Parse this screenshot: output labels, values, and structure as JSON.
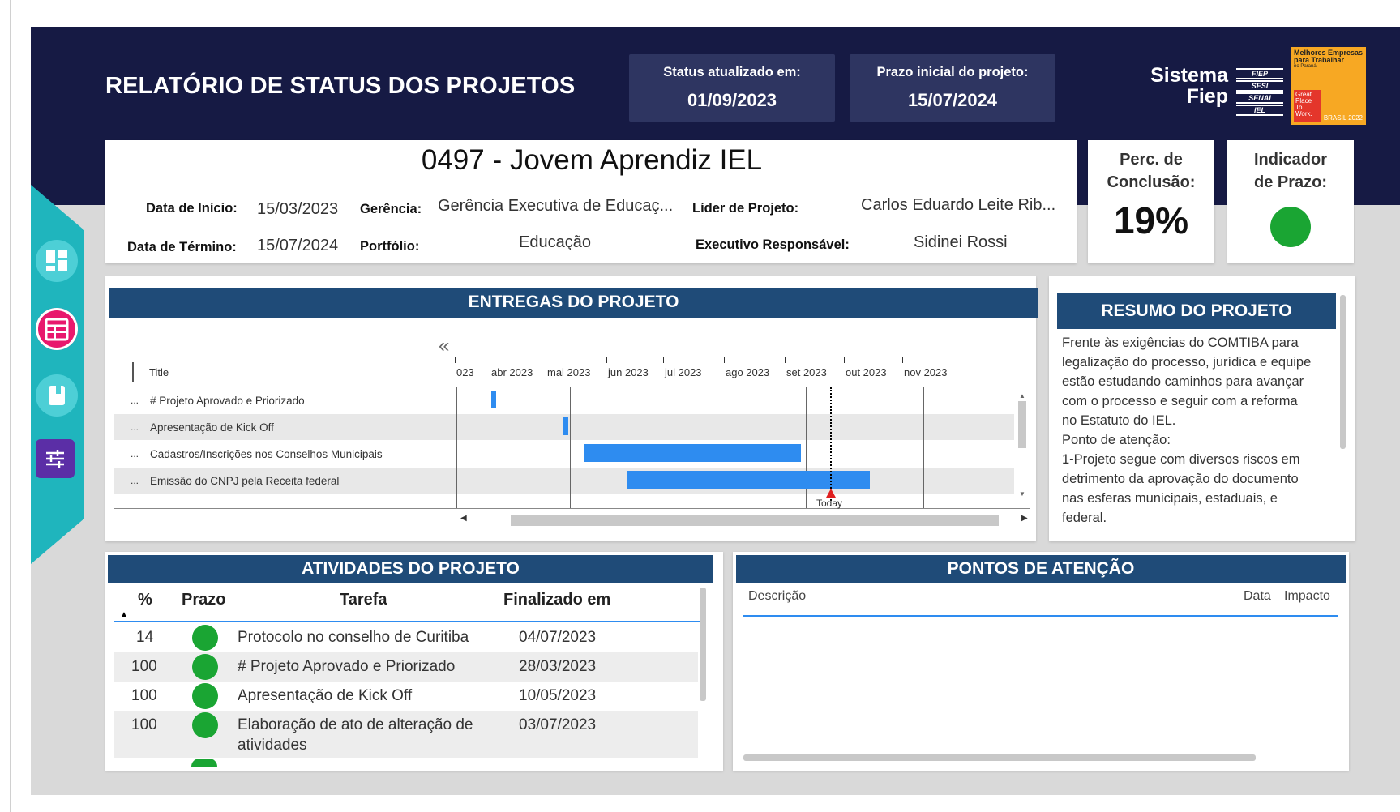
{
  "header": {
    "title": "RELATÓRIO DE STATUS DOS PROJETOS",
    "status_label": "Status atualizado em:",
    "status_date": "01/09/2023",
    "deadline_label": "Prazo inicial do projeto:",
    "deadline_date": "15/07/2024",
    "logo_line1": "Sistema",
    "logo_line2": "Fiep",
    "logo_bars": [
      "FIEP",
      "SESI",
      "SENAI",
      "IEL"
    ],
    "gptw_top": "Melhores Empresas para Trabalhar",
    "gptw_sub": "no Paraná",
    "gptw_badge": "Great Place To Work.",
    "gptw_year": "BRASIL 2022"
  },
  "nav": {
    "icons": [
      "dashboard-icon",
      "calendar-table-icon",
      "book-icon",
      "sliders-icon"
    ],
    "colors": [
      "#4dcfd6",
      "#e8186d",
      "#4dcfd6",
      "#5b2ea6"
    ]
  },
  "project": {
    "name": "0497 - Jovem Aprendiz IEL",
    "start_label": "Data de Início:",
    "start_value": "15/03/2023",
    "end_label": "Data de Término:",
    "end_value": "15/07/2024",
    "management_label": "Gerência:",
    "management_value": "Gerência Executiva de Educaç...",
    "portfolio_label": "Portfólio:",
    "portfolio_value": "Educação",
    "leader_label": "Líder de Projeto:",
    "leader_value": "Carlos Eduardo Leite Rib...",
    "executive_label": "Executivo Responsável:",
    "executive_value": "Sidinei Rossi"
  },
  "kpis": {
    "completion_label_1": "Perc. de",
    "completion_label_2": "Conclusão:",
    "completion_value": "19%",
    "completion_fraction": 0.19,
    "deadline_label_1": "Indicador",
    "deadline_label_2": "de Prazo:",
    "deadline_status_color": "#1aa533"
  },
  "deliveries": {
    "title": "ENTREGAS DO PROJETO",
    "collapse_glyph": "«",
    "title_column": "Title",
    "ellipsis": "...",
    "months": [
      "023",
      "abr 2023",
      "mai 2023",
      "jun 2023",
      "jul 2023",
      "ago 2023",
      "set 2023",
      "out 2023",
      "nov 2023"
    ],
    "today_label": "Today",
    "rows": [
      {
        "label": "# Projeto Aprovado e Priorizado"
      },
      {
        "label": "Apresentação de Kick Off"
      },
      {
        "label": "Cadastros/Inscrições nos Conselhos Municipais"
      },
      {
        "label": "Emissão do CNPJ pela Receita federal"
      }
    ]
  },
  "summary": {
    "title": "RESUMO DO PROJETO",
    "lines": [
      "Frente às exigências do COMTIBA para",
      "legalização do processo, jurídica e equipe",
      "estão estudando caminhos para avançar",
      "com o processo e seguir com a reforma",
      "no Estatuto do IEL.",
      "Ponto de atenção:",
      "1-Projeto segue com diversos riscos em",
      "detrimento da aprovação do documento",
      "nas esferas municipais, estaduais, e",
      "federal."
    ]
  },
  "activities": {
    "title": "ATIVIDADES DO PROJETO",
    "columns": [
      "%",
      "Prazo",
      "Tarefa",
      "Finalizado em"
    ],
    "rows": [
      {
        "pct": "14",
        "task": "Protocolo no conselho de Curitiba",
        "task2": "",
        "done": "04/07/2023"
      },
      {
        "pct": "100",
        "task": "# Projeto Aprovado e Priorizado",
        "task2": "",
        "done": "28/03/2023"
      },
      {
        "pct": "100",
        "task": "Apresentação de Kick Off",
        "task2": "",
        "done": "10/05/2023"
      },
      {
        "pct": "100",
        "task": "Elaboração de ato de alteração de",
        "task2": "atividades",
        "done": "03/07/2023"
      }
    ]
  },
  "attention": {
    "title": "PONTOS DE ATENÇÃO",
    "columns": [
      "Descrição",
      "Data",
      "Impacto"
    ]
  }
}
